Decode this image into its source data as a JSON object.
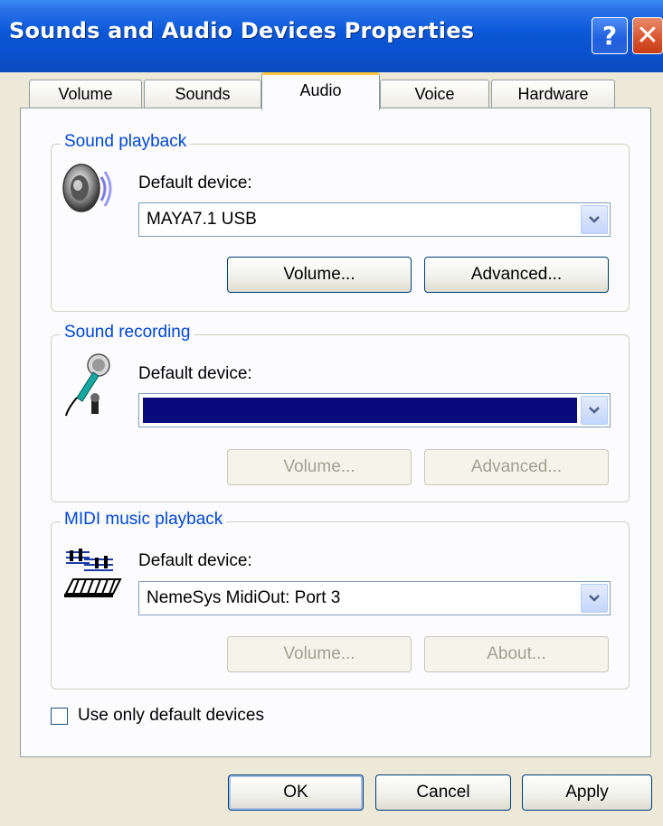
{
  "window": {
    "title": "Sounds and Audio Devices Properties",
    "help_glyph": "?",
    "close_glyph": "✕"
  },
  "tabs": [
    {
      "label": "Volume",
      "active": false
    },
    {
      "label": "Sounds",
      "active": false
    },
    {
      "label": "Audio",
      "active": true
    },
    {
      "label": "Voice",
      "active": false
    },
    {
      "label": "Hardware",
      "active": false
    }
  ],
  "playback": {
    "group_title": "Sound playback",
    "default_label": "Default device:",
    "device": "MAYA7.1 USB",
    "volume_button": "Volume...",
    "advanced_button": "Advanced..."
  },
  "recording": {
    "group_title": "Sound recording",
    "default_label": "Default device:",
    "device": "",
    "volume_button": "Volume...",
    "advanced_button": "Advanced..."
  },
  "midi": {
    "group_title": "MIDI music playback",
    "default_label": "Default device:",
    "device": "NemeSys MidiOut: Port 3",
    "volume_button": "Volume...",
    "about_button": "About..."
  },
  "use_default_only": {
    "label": "Use only default devices",
    "checked": false
  },
  "footer": {
    "ok": "OK",
    "cancel": "Cancel",
    "apply": "Apply"
  },
  "colors": {
    "title_bar": "#0a58d8",
    "group_title": "#0046d5",
    "selection": "#0a0a7c",
    "active_tab_accent": "#ffc83c"
  }
}
